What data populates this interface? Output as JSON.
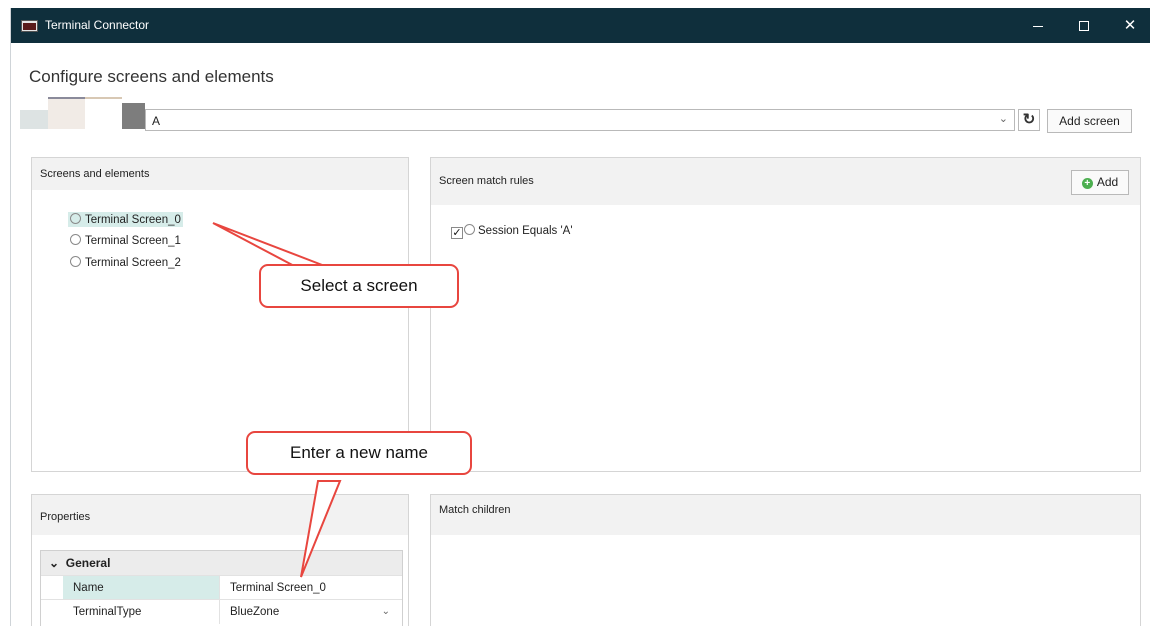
{
  "window": {
    "title": "Terminal Connector",
    "minimize_icon": "minimize-icon",
    "maximize_icon": "maximize-icon",
    "close_label": "✕"
  },
  "header": {
    "heading": "Configure screens and elements"
  },
  "session_bar": {
    "selected_session": "A",
    "dropdown_icon": "chevron-down-icon",
    "refresh_icon": "refresh-icon",
    "refresh_glyph": "↻",
    "add_screen_label": "Add screen"
  },
  "screens_panel": {
    "title": "Screens and elements",
    "items": [
      {
        "label": "Terminal Screen_0",
        "selected": true
      },
      {
        "label": "Terminal Screen_1",
        "selected": false
      },
      {
        "label": "Terminal Screen_2",
        "selected": false
      }
    ]
  },
  "rules_panel": {
    "title": "Screen match rules",
    "add_label": "Add",
    "add_glyph": "+",
    "rules": [
      {
        "label": "Session Equals 'A'",
        "checked": true,
        "check_glyph": "✓"
      }
    ]
  },
  "properties_panel": {
    "title": "Properties",
    "group_label": "General",
    "group_glyph": "⌄",
    "rows": [
      {
        "key": "Name",
        "value": "Terminal Screen_0"
      },
      {
        "key": "TerminalType",
        "value": "BlueZone",
        "dropdown_glyph": "⌄"
      }
    ]
  },
  "children_panel": {
    "title": "Match children"
  },
  "callouts": {
    "select_screen": "Select a screen",
    "enter_name": "Enter a new name"
  },
  "colors": {
    "titlebar_bg": "#0f2f3c",
    "selection_bg": "#d6ece9",
    "callout_border": "#e8463f",
    "add_icon": "#4caf50"
  }
}
